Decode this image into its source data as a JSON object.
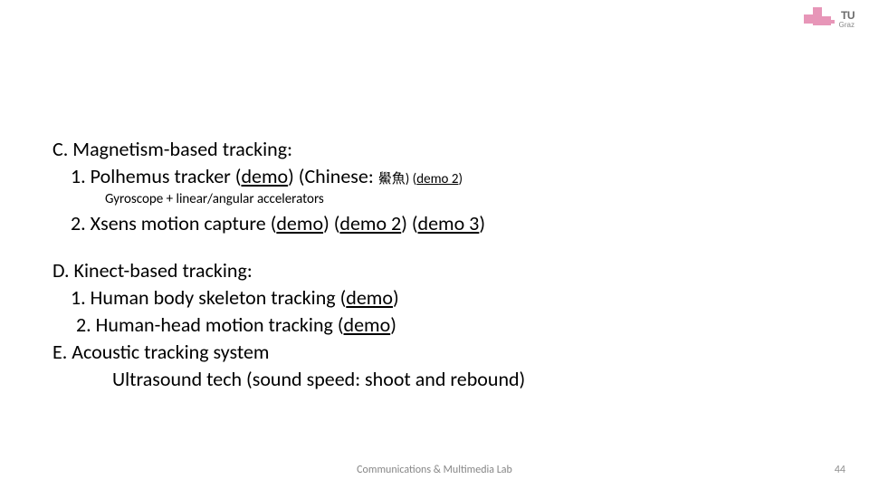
{
  "logo": {
    "main": "TU",
    "sub": "Graz"
  },
  "content": {
    "c": {
      "heading": "C.   Magnetism-based tracking:",
      "item1_prefix": "1. Polhemus tracker  (",
      "item1_link1": "demo",
      "item1_mid1": ") (Chinese: ",
      "item1_cjk": "鱟魚",
      "item1_mid2": ") (",
      "item1_link2": "demo 2",
      "item1_suffix": ")",
      "note": "Gyroscope + linear/angular accelerators",
      "item2_prefix": "2. Xsens motion capture (",
      "item2_link1": "demo",
      "item2_mid1": ")  (",
      "item2_link2": "demo 2",
      "item2_mid2": ") (",
      "item2_link3": "demo 3",
      "item2_suffix": ")"
    },
    "d": {
      "heading": "D.   Kinect-based tracking:",
      "item1_prefix": "1.  Human body skeleton tracking  (",
      "item1_link": "demo",
      "item1_suffix": ")",
      "item2_prefix": "2.  Human-head motion tracking (",
      "item2_link": "demo",
      "item2_suffix": ")"
    },
    "e": {
      "heading": "E.   Acoustic tracking system",
      "line1": "Ultrasound tech  (sound speed: shoot and rebound)"
    }
  },
  "footer": {
    "center": "Communications & Multimedia Lab",
    "page": "44"
  }
}
